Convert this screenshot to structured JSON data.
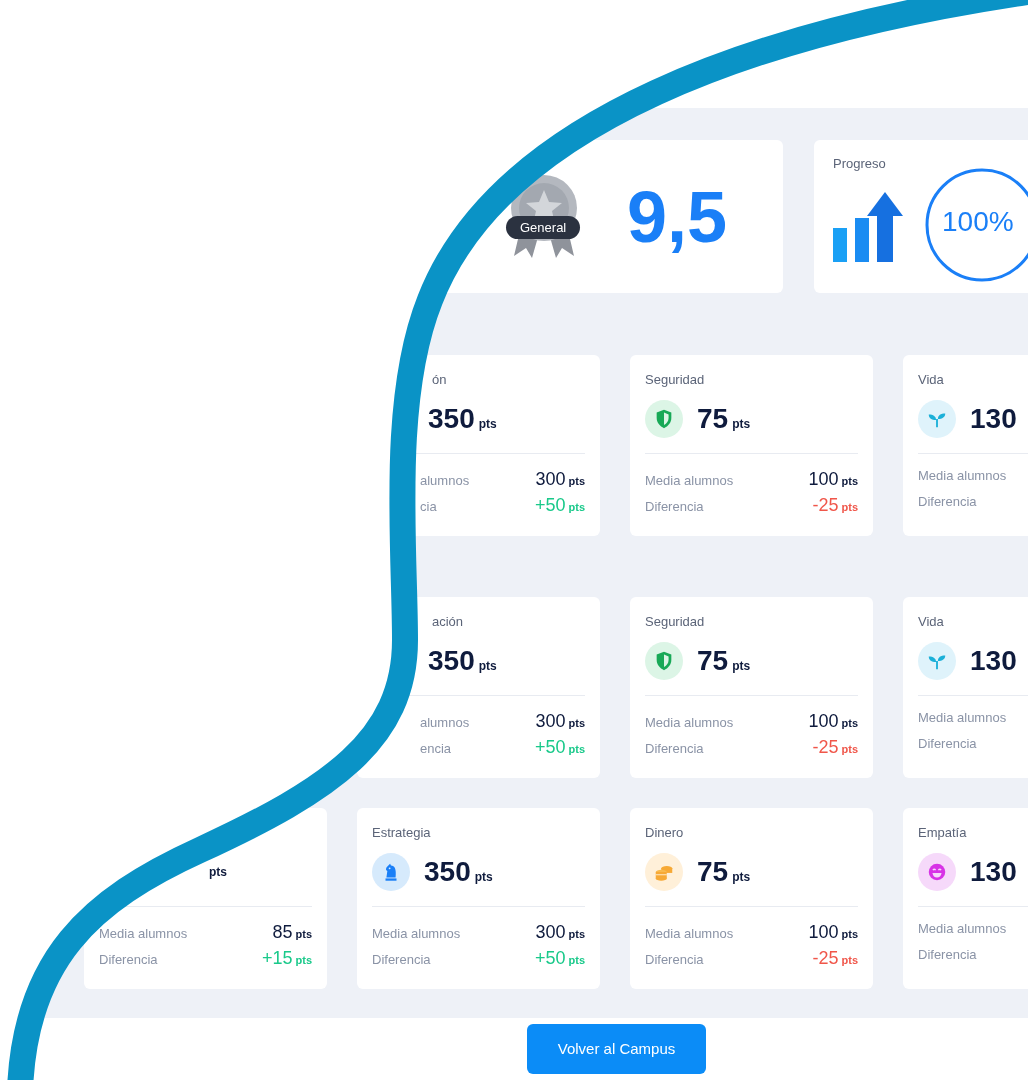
{
  "summary": {
    "badge": "General",
    "score": "9,5"
  },
  "progress": {
    "title": "Progreso",
    "reading": "100%",
    "level": 1
  },
  "card_groups": [
    {
      "rows": [
        {
          "cards": [
            {
              "kind": "cut",
              "title": "ón",
              "points": "350",
              "unit": "pts",
              "stats": [
                {
                  "kind": "average",
                  "label": "alumnos",
                  "value": "300",
                  "unit": "pts"
                },
                {
                  "kind": "gain",
                  "label": "cia",
                  "value": "+50",
                  "unit": "pts"
                }
              ]
            },
            {
              "title": "Seguridad",
              "kind": "shield",
              "points": "75",
              "unit": "pts",
              "stats": [
                {
                  "kind": "average",
                  "label": "Media alumnos",
                  "value": "100",
                  "unit": "pts"
                },
                {
                  "kind": "loss",
                  "label": "Diferencia",
                  "value": "-25",
                  "unit": "pts"
                }
              ]
            },
            {
              "title": "Vida",
              "kind": "sprout",
              "points": "130",
              "stats": [
                {
                  "label": "Media alumnos"
                },
                {
                  "label": "Diferencia"
                }
              ]
            }
          ]
        }
      ]
    },
    {
      "rows": [
        {
          "cards": [
            {
              "kind": "cut",
              "title": "ación",
              "points": "350",
              "unit": "pts",
              "stats": [
                {
                  "kind": "average",
                  "label": "alumnos",
                  "value": "300",
                  "unit": "pts"
                },
                {
                  "kind": "gain",
                  "label": "encia",
                  "value": "+50",
                  "unit": "pts"
                }
              ]
            },
            {
              "title": "Seguridad",
              "kind": "shield",
              "points": "75",
              "unit": "pts",
              "stats": [
                {
                  "kind": "average",
                  "label": "Media alumnos",
                  "value": "100",
                  "unit": "pts"
                },
                {
                  "kind": "loss",
                  "label": "Diferencia",
                  "value": "-25",
                  "unit": "pts"
                }
              ]
            },
            {
              "title": "Vida",
              "kind": "sprout",
              "points": "130",
              "stats": [
                {
                  "label": "Media alumnos"
                },
                {
                  "label": "Diferencia"
                }
              ]
            }
          ]
        },
        {
          "cards": [
            {
              "kind": "corner",
              "unit": "pts",
              "stats": [
                {
                  "kind": "average",
                  "label": "Media alumnos",
                  "value": "85",
                  "unit": "pts"
                },
                {
                  "kind": "gain",
                  "label": "Diferencia",
                  "value": "+15",
                  "unit": "pts"
                }
              ]
            },
            {
              "title": "Estrategia",
              "kind": "knight",
              "points": "350",
              "unit": "pts",
              "stats": [
                {
                  "kind": "average",
                  "label": "Media alumnos",
                  "value": "300",
                  "unit": "pts"
                },
                {
                  "kind": "gain",
                  "label": "Diferencia",
                  "value": "+50",
                  "unit": "pts"
                }
              ]
            },
            {
              "title": "Dinero",
              "kind": "coins",
              "points": "75",
              "unit": "pts",
              "stats": [
                {
                  "kind": "average",
                  "label": "Media alumnos",
                  "value": "100",
                  "unit": "pts"
                },
                {
                  "kind": "loss",
                  "label": "Diferencia",
                  "value": "-25",
                  "unit": "pts"
                }
              ]
            },
            {
              "title": "Empatía",
              "kind": "smile",
              "points": "130",
              "stats": [
                {
                  "label": "Media alumnos"
                },
                {
                  "label": "Diferencia"
                }
              ]
            }
          ]
        }
      ]
    }
  ],
  "button": "Volver al Campus"
}
